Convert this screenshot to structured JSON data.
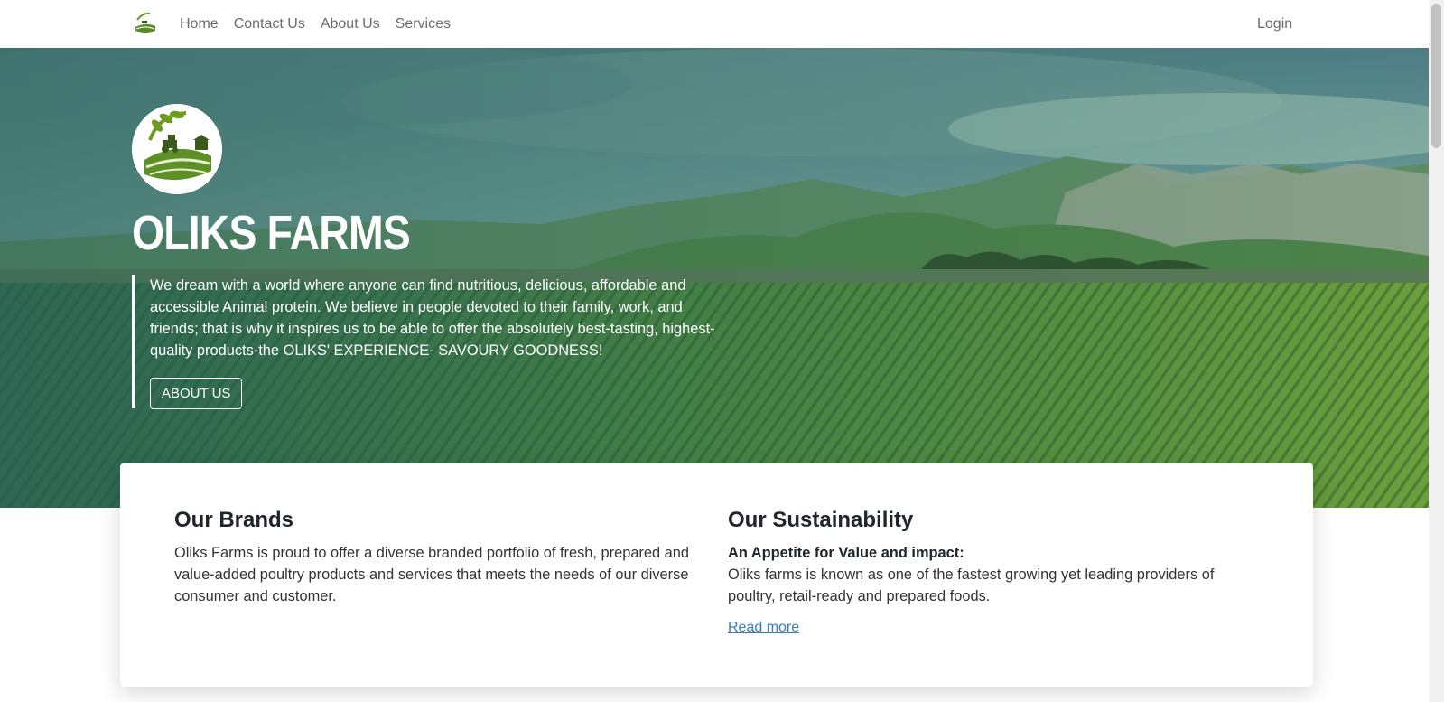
{
  "nav": {
    "logo_icon": "farm-logo-icon",
    "links": [
      {
        "label": "Home"
      },
      {
        "label": "Contact Us"
      },
      {
        "label": "About Us"
      },
      {
        "label": "Services"
      }
    ],
    "login_label": "Login"
  },
  "hero": {
    "title": "OLIKS FARMS",
    "text": "We dream with a world where anyone can find nutritious, delicious, affordable and accessible Animal protein. We believe in people devoted to their family, work, and friends; that is why it inspires us to be able to offer the absolutely best-tasting, highest-quality products-the OLIKS' EXPERIENCE- SAVOURY GOODNESS!",
    "button_label": "ABOUT US",
    "overlay_color": "#3f7a6a"
  },
  "brands": {
    "heading": "Our Brands",
    "text": "Oliks Farms is proud to offer a diverse branded portfolio of fresh, prepared and value-added poultry products and services that meets the needs of our diverse consumer and customer."
  },
  "sustainability": {
    "heading": "Our Sustainability",
    "subheading": "An Appetite for Value and impact:",
    "text": "Oliks farms is known as one of the fastest growing yet leading providers of poultry, retail-ready and prepared foods.",
    "link_label": "Read more"
  }
}
